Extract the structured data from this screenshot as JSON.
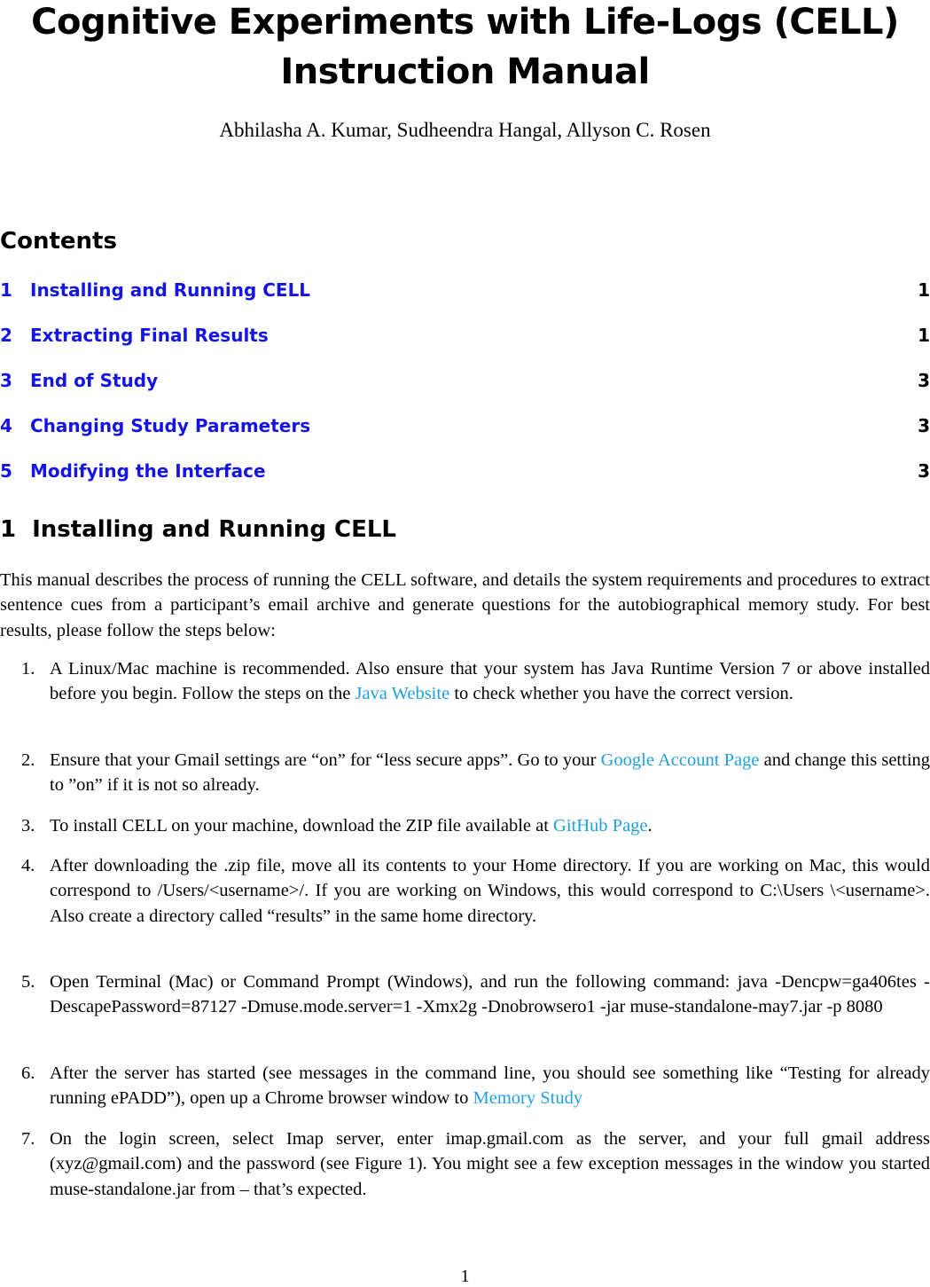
{
  "title": {
    "line1": "Cognitive Experiments with Life-Logs (CELL)",
    "line2": "Instruction Manual"
  },
  "authors": "Abhilasha A. Kumar, Sudheendra Hangal, Allyson C. Rosen",
  "contents": {
    "heading": "Contents",
    "entries": [
      {
        "num": "1",
        "label": "Installing and Running CELL",
        "page": "1"
      },
      {
        "num": "2",
        "label": "Extracting Final Results",
        "page": "1"
      },
      {
        "num": "3",
        "label": "End of Study",
        "page": "3"
      },
      {
        "num": "4",
        "label": "Changing Study Parameters",
        "page": "3"
      },
      {
        "num": "5",
        "label": "Modifying the Interface",
        "page": "3"
      }
    ]
  },
  "section1": {
    "num": "1",
    "heading": "Installing and Running CELL",
    "intro": "This manual describes the process of running the CELL software, and details the system requirements and procedures to extract sentence cues from a participant’s email archive and generate questions for the autobiographical memory study. For best results, please follow the steps below:",
    "steps": [
      {
        "num": "1.",
        "before": "A Linux/Mac machine is recommended.  Also ensure that your system has Java Runtime Version 7 or above installed before you begin. Follow the steps on the ",
        "link": "Java Website",
        "after": " to check whether you have the correct version."
      },
      {
        "num": "2.",
        "before": "Ensure that your Gmail settings are “on” for “less secure apps”.  Go to your ",
        "link": "Google Account Page",
        "after": " and change this setting to ”on” if it is not so already."
      },
      {
        "num": "3.",
        "before": "To install CELL on your machine, download the ZIP file available at ",
        "link": "GitHub Page",
        "after": "."
      },
      {
        "num": "4.",
        "before": "After downloading the .zip file, move all its contents to your Home directory. If you are working on Mac, this would correspond to /Users/<username>/.  If you are working on Windows, this would correspond to C:\\Users \\<username>.  Also create a directory called “results” in the same home directory.",
        "link": "",
        "after": ""
      },
      {
        "num": "5.",
        "before": "Open Terminal (Mac) or Command Prompt (Windows), and run the following command: java -Dencpw=ga406tes -DescapePassword=87127 -Dmuse.mode.server=1 -Xmx2g -Dnobrowsero1 -jar muse-standalone-may7.jar -p 8080",
        "link": "",
        "after": ""
      },
      {
        "num": "6.",
        "before": "After the server has started (see messages in the command line, you should see something like “Testing for already running ePADD”), open up a Chrome browser window to ",
        "link": "Memory Study",
        "after": ""
      },
      {
        "num": "7.",
        "before": "On the login screen, select Imap server, enter imap.gmail.com as the server, and your full gmail address (xyz@gmail.com) and the password (see Figure 1). You might see a few exception messages in the window you started muse-standalone.jar from – that’s expected.",
        "link": "",
        "after": ""
      }
    ]
  },
  "page_number": "1"
}
